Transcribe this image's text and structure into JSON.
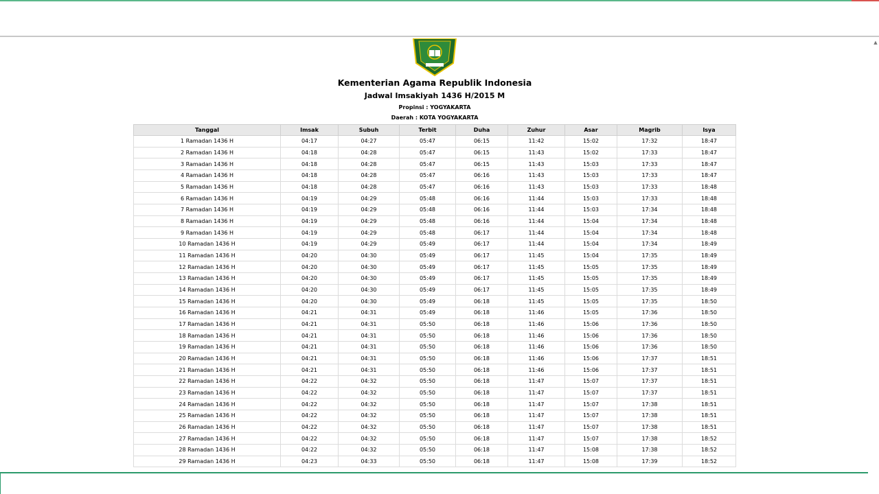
{
  "header": {
    "ministry": "Kementerian Agama Republik Indonesia",
    "schedule_title": "Jadwal Imsakiyah 1436 H/2015 M",
    "province": "Propinsi : YOGYAKARTA",
    "region": "Daerah : KOTA YOGYAKARTA"
  },
  "colors": {
    "accent": "#5ab88a",
    "logo_green": "#1f6b2a",
    "logo_gold": "#e6c200"
  },
  "table": {
    "columns": [
      "Tanggal",
      "Imsak",
      "Subuh",
      "Terbit",
      "Duha",
      "Zuhur",
      "Asar",
      "Magrib",
      "Isya"
    ],
    "rows": [
      [
        "1 Ramadan 1436 H",
        "04:17",
        "04:27",
        "05:47",
        "06:15",
        "11:42",
        "15:02",
        "17:32",
        "18:47"
      ],
      [
        "2 Ramadan 1436 H",
        "04:18",
        "04:28",
        "05:47",
        "06:15",
        "11:43",
        "15:02",
        "17:33",
        "18:47"
      ],
      [
        "3 Ramadan 1436 H",
        "04:18",
        "04:28",
        "05:47",
        "06:15",
        "11:43",
        "15:03",
        "17:33",
        "18:47"
      ],
      [
        "4 Ramadan 1436 H",
        "04:18",
        "04:28",
        "05:47",
        "06:16",
        "11:43",
        "15:03",
        "17:33",
        "18:47"
      ],
      [
        "5 Ramadan 1436 H",
        "04:18",
        "04:28",
        "05:47",
        "06:16",
        "11:43",
        "15:03",
        "17:33",
        "18:48"
      ],
      [
        "6 Ramadan 1436 H",
        "04:19",
        "04:29",
        "05:48",
        "06:16",
        "11:44",
        "15:03",
        "17:33",
        "18:48"
      ],
      [
        "7 Ramadan 1436 H",
        "04:19",
        "04:29",
        "05:48",
        "06:16",
        "11:44",
        "15:03",
        "17:34",
        "18:48"
      ],
      [
        "8 Ramadan 1436 H",
        "04:19",
        "04:29",
        "05:48",
        "06:16",
        "11:44",
        "15:04",
        "17:34",
        "18:48"
      ],
      [
        "9 Ramadan 1436 H",
        "04:19",
        "04:29",
        "05:48",
        "06:17",
        "11:44",
        "15:04",
        "17:34",
        "18:48"
      ],
      [
        "10 Ramadan 1436 H",
        "04:19",
        "04:29",
        "05:49",
        "06:17",
        "11:44",
        "15:04",
        "17:34",
        "18:49"
      ],
      [
        "11 Ramadan 1436 H",
        "04:20",
        "04:30",
        "05:49",
        "06:17",
        "11:45",
        "15:04",
        "17:35",
        "18:49"
      ],
      [
        "12 Ramadan 1436 H",
        "04:20",
        "04:30",
        "05:49",
        "06:17",
        "11:45",
        "15:05",
        "17:35",
        "18:49"
      ],
      [
        "13 Ramadan 1436 H",
        "04:20",
        "04:30",
        "05:49",
        "06:17",
        "11:45",
        "15:05",
        "17:35",
        "18:49"
      ],
      [
        "14 Ramadan 1436 H",
        "04:20",
        "04:30",
        "05:49",
        "06:17",
        "11:45",
        "15:05",
        "17:35",
        "18:49"
      ],
      [
        "15 Ramadan 1436 H",
        "04:20",
        "04:30",
        "05:49",
        "06:18",
        "11:45",
        "15:05",
        "17:35",
        "18:50"
      ],
      [
        "16 Ramadan 1436 H",
        "04:21",
        "04:31",
        "05:49",
        "06:18",
        "11:46",
        "15:05",
        "17:36",
        "18:50"
      ],
      [
        "17 Ramadan 1436 H",
        "04:21",
        "04:31",
        "05:50",
        "06:18",
        "11:46",
        "15:06",
        "17:36",
        "18:50"
      ],
      [
        "18 Ramadan 1436 H",
        "04:21",
        "04:31",
        "05:50",
        "06:18",
        "11:46",
        "15:06",
        "17:36",
        "18:50"
      ],
      [
        "19 Ramadan 1436 H",
        "04:21",
        "04:31",
        "05:50",
        "06:18",
        "11:46",
        "15:06",
        "17:36",
        "18:50"
      ],
      [
        "20 Ramadan 1436 H",
        "04:21",
        "04:31",
        "05:50",
        "06:18",
        "11:46",
        "15:06",
        "17:37",
        "18:51"
      ],
      [
        "21 Ramadan 1436 H",
        "04:21",
        "04:31",
        "05:50",
        "06:18",
        "11:46",
        "15:06",
        "17:37",
        "18:51"
      ],
      [
        "22 Ramadan 1436 H",
        "04:22",
        "04:32",
        "05:50",
        "06:18",
        "11:47",
        "15:07",
        "17:37",
        "18:51"
      ],
      [
        "23 Ramadan 1436 H",
        "04:22",
        "04:32",
        "05:50",
        "06:18",
        "11:47",
        "15:07",
        "17:37",
        "18:51"
      ],
      [
        "24 Ramadan 1436 H",
        "04:22",
        "04:32",
        "05:50",
        "06:18",
        "11:47",
        "15:07",
        "17:38",
        "18:51"
      ],
      [
        "25 Ramadan 1436 H",
        "04:22",
        "04:32",
        "05:50",
        "06:18",
        "11:47",
        "15:07",
        "17:38",
        "18:51"
      ],
      [
        "26 Ramadan 1436 H",
        "04:22",
        "04:32",
        "05:50",
        "06:18",
        "11:47",
        "15:07",
        "17:38",
        "18:51"
      ],
      [
        "27 Ramadan 1436 H",
        "04:22",
        "04:32",
        "05:50",
        "06:18",
        "11:47",
        "15:07",
        "17:38",
        "18:52"
      ],
      [
        "28 Ramadan 1436 H",
        "04:22",
        "04:32",
        "05:50",
        "06:18",
        "11:47",
        "15:08",
        "17:38",
        "18:52"
      ],
      [
        "29 Ramadan 1436 H",
        "04:23",
        "04:33",
        "05:50",
        "06:18",
        "11:47",
        "15:08",
        "17:39",
        "18:52"
      ]
    ]
  }
}
